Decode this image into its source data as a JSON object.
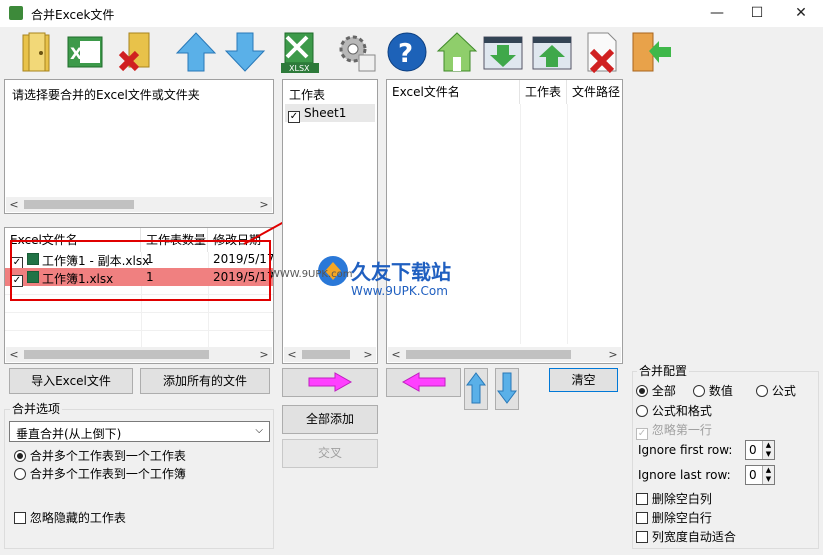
{
  "window": {
    "title": "合并Excek文件",
    "controls": [
      "—",
      "☐",
      "✕"
    ]
  },
  "toolbar": {
    "buttons": [
      "open-folder",
      "add-excel",
      "remove-folder",
      "move-up",
      "move-down",
      "export-xlsx",
      "settings",
      "help",
      "home",
      "import-list",
      "export-list",
      "delete-file",
      "exit"
    ]
  },
  "left_top": {
    "prompt": "请选择要合并的Excel文件或文件夹"
  },
  "file_table": {
    "headers": [
      "Excel文件名",
      "工作表数量",
      "修改日期"
    ],
    "rows": [
      {
        "name": "工作簿1 - 副本.xlsx",
        "count": "1",
        "date": "2019/5/17"
      },
      {
        "name": "工作簿1.xlsx",
        "count": "1",
        "date": "2019/5/17"
      }
    ]
  },
  "sheet_list": {
    "header": "工作表",
    "items": [
      "Sheet1"
    ]
  },
  "result_table": {
    "headers": [
      "Excel文件名",
      "工作表",
      "文件路径"
    ]
  },
  "buttons": {
    "import_excel": "导入Excel文件",
    "add_all_files": "添加所有的文件",
    "add_all": "全部添加",
    "cross": "交叉",
    "clear": "清空"
  },
  "merge_options": {
    "title": "合并选项",
    "mode": "垂直合并(从上倒下)",
    "radio1": "合并多个工作表到一个工作表",
    "radio2": "合并多个工作表到一个工作簿",
    "ignore_hidden": "忽略隐藏的工作表"
  },
  "merge_config": {
    "title": "合并配置",
    "opt_all": "全部",
    "opt_values": "数值",
    "opt_formula": "公式",
    "opt_formula_format": "公式和格式",
    "ignore_first_row_cn": "忽略第一行",
    "ignore_first_row": "Ignore first row:",
    "ignore_first_value": "0",
    "ignore_last_row": "Ignore last row:",
    "ignore_last_value": "0",
    "del_empty_cols": "删除空白列",
    "del_empty_rows": "删除空白行",
    "autofit": "列宽度自动适合"
  },
  "watermark": {
    "brand": "久友下载站",
    "url": "Www.9UPK.Com",
    "side": "WWW.9UPK.com"
  },
  "colors": {
    "selected_row": "#f08080",
    "highlight_box": "#e00000",
    "arrow_magenta": "#ff40ff"
  }
}
